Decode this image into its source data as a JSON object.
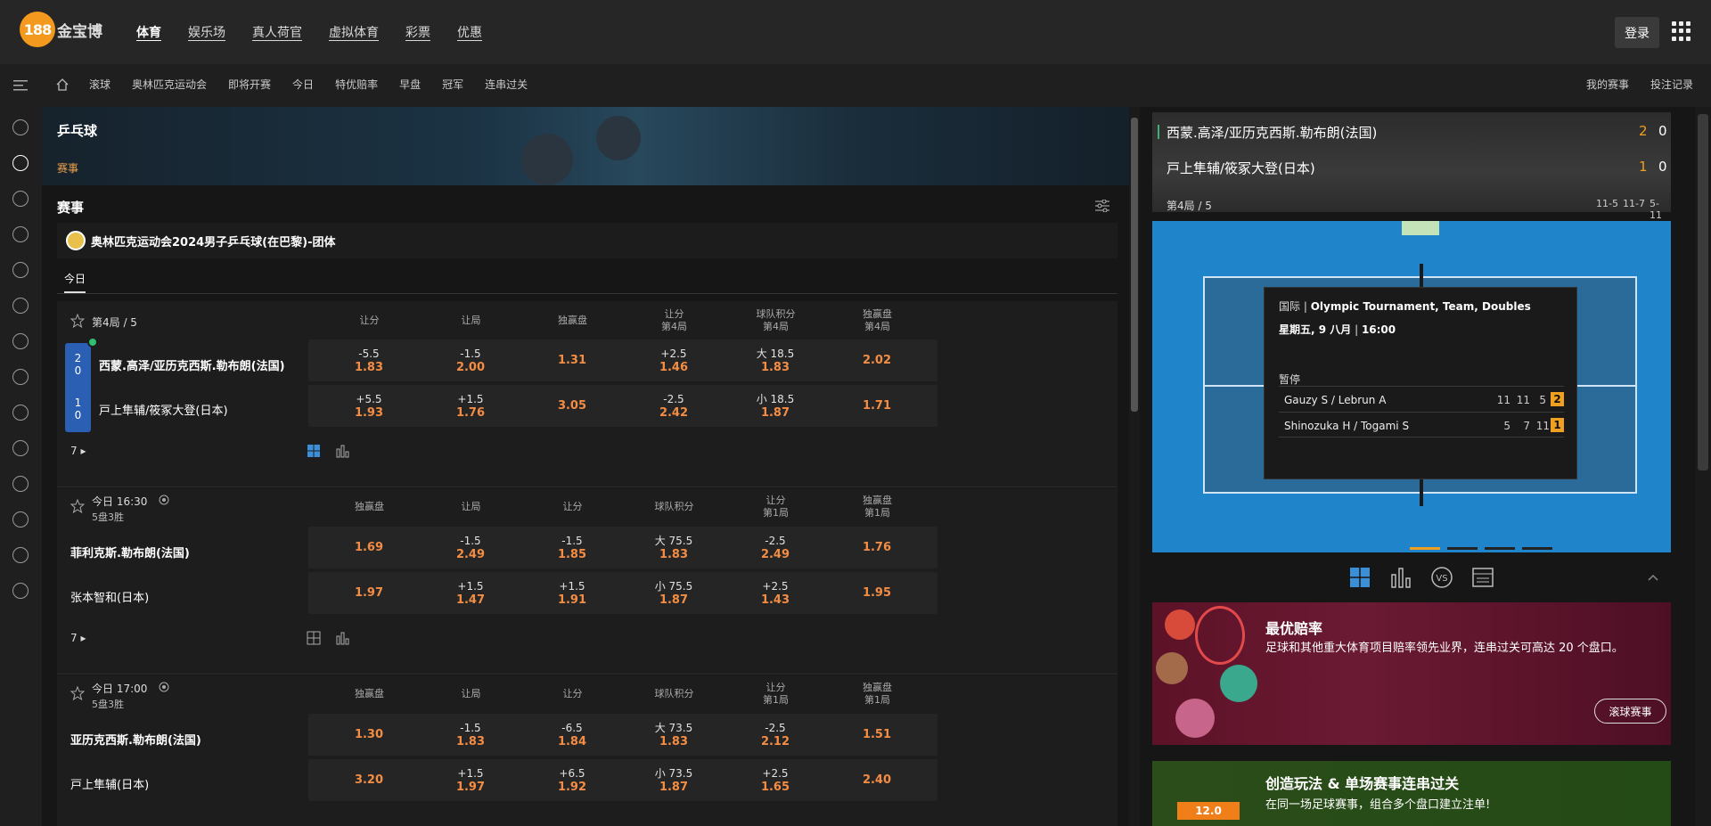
{
  "brand": {
    "logo_mark": "188",
    "logo_text": "金宝博"
  },
  "topnav": {
    "items": [
      "体育",
      "娱乐场",
      "真人荷官",
      "虚拟体育",
      "彩票",
      "优惠"
    ],
    "login": "登录"
  },
  "subnav": {
    "items": [
      "滚球",
      "奥林匹克运动会",
      "即将开赛",
      "今日",
      "特优赔率",
      "早盘",
      "冠军",
      "连串过关"
    ],
    "right": [
      "我的赛事",
      "投注记录"
    ]
  },
  "banner": {
    "title": "乒乓球",
    "subtitle": "赛事"
  },
  "section": {
    "title": "赛事",
    "tab": "今日"
  },
  "league": {
    "name": "奥林匹克运动会2024男子乒乓球(在巴黎)-团体"
  },
  "matches": [
    {
      "status": "第4局 / 5",
      "sub": "",
      "headers": [
        "让分",
        "让局",
        "独赢盘",
        "让分\n第4局",
        "球队积分\n第4局",
        "独赢盘\n第4局"
      ],
      "team1": "西蒙.高泽/亚历克西斯.勒布朗(法国)",
      "team2": "戸上隼辅/筱冢大登(日本)",
      "score1": [
        "2",
        "0"
      ],
      "score2": [
        "1",
        "0"
      ],
      "odds1": [
        [
          "-5.5",
          "1.83"
        ],
        [
          "-1.5",
          "2.00"
        ],
        [
          "",
          "1.31"
        ],
        [
          "+2.5",
          "1.46"
        ],
        [
          "大 18.5",
          "1.83"
        ],
        [
          "",
          "2.02"
        ]
      ],
      "odds2": [
        [
          "+5.5",
          "1.93"
        ],
        [
          "+1.5",
          "1.76"
        ],
        [
          "",
          "3.05"
        ],
        [
          "-2.5",
          "2.42"
        ],
        [
          "小 18.5",
          "1.87"
        ],
        [
          "",
          "1.71"
        ]
      ],
      "more": "7"
    },
    {
      "status": "今日 16:30",
      "sub": "5盘3胜",
      "headers": [
        "独赢盘",
        "让局",
        "让分",
        "球队积分",
        "让分\n第1局",
        "独赢盘\n第1局"
      ],
      "team1": "菲利克斯.勒布朗(法国)",
      "team2": "张本智和(日本)",
      "odds1": [
        [
          "",
          "1.69"
        ],
        [
          "-1.5",
          "2.49"
        ],
        [
          "-1.5",
          "1.85"
        ],
        [
          "大 75.5",
          "1.83"
        ],
        [
          "-2.5",
          "2.49"
        ],
        [
          "",
          "1.76"
        ]
      ],
      "odds2": [
        [
          "",
          "1.97"
        ],
        [
          "+1.5",
          "1.47"
        ],
        [
          "+1.5",
          "1.91"
        ],
        [
          "小 75.5",
          "1.87"
        ],
        [
          "+2.5",
          "1.43"
        ],
        [
          "",
          "1.95"
        ]
      ],
      "more": "7"
    },
    {
      "status": "今日 17:00",
      "sub": "5盘3胜",
      "headers": [
        "独赢盘",
        "让局",
        "让分",
        "球队积分",
        "让分\n第1局",
        "独赢盘\n第1局"
      ],
      "team1": "亚历克西斯.勒布朗(法国)",
      "team2": "戸上隼辅(日本)",
      "odds1": [
        [
          "",
          "1.30"
        ],
        [
          "-1.5",
          "1.83"
        ],
        [
          "-6.5",
          "1.84"
        ],
        [
          "大 73.5",
          "1.83"
        ],
        [
          "-2.5",
          "2.12"
        ],
        [
          "",
          "1.51"
        ]
      ],
      "odds2": [
        [
          "",
          "3.20"
        ],
        [
          "+1.5",
          "1.97"
        ],
        [
          "+6.5",
          "1.92"
        ],
        [
          "小 73.5",
          "1.87"
        ],
        [
          "+2.5",
          "1.65"
        ],
        [
          "",
          "2.40"
        ]
      ]
    }
  ],
  "scoreboard": {
    "team1": "西蒙.高泽/亚历克西斯.勒布朗(法国)",
    "team2": "戸上隼辅/筱冢大登(日本)",
    "t1_sets": "2",
    "t1_games": "0",
    "t2_sets": "1",
    "t2_games": "0",
    "period": "第4局 / 5",
    "set_scores": [
      "11-5",
      "11-7",
      "5-11"
    ]
  },
  "live_popup": {
    "category": "国际",
    "competition": "Olympic Tournament, Team, Doubles",
    "day": "星期五, 9 八月",
    "time": "16:00",
    "state": "暂停",
    "p1_name": "Gauzy S / Lebrun A",
    "p1_scores": [
      "11",
      "11",
      "5"
    ],
    "p1_current": "2",
    "p2_name": "Shinozuka H / Togami S",
    "p2_scores": [
      "5",
      "7",
      "11"
    ],
    "p2_current": "1"
  },
  "promos": [
    {
      "title": "最优赔率",
      "desc": "足球和其他重大体育项目赔率领先业界，连串过关可高达 20 个盘口。",
      "button": "滚球赛事"
    },
    {
      "title": "创造玩法 & 单场赛事连串过关",
      "desc": "在同一场足球赛事，组合多个盘口建立注单!",
      "badge": "12.0"
    }
  ],
  "colors": {
    "accent": "#f48d44",
    "brand": "#f39a1e",
    "live": "#2fbf71",
    "score_box": "#2a5fb3"
  }
}
